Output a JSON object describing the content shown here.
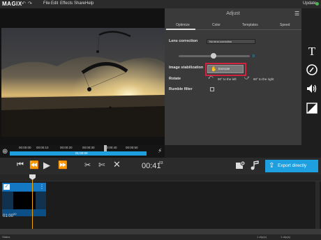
{
  "app": {
    "logo": "MAGIX",
    "undo_icon": "undo-icon",
    "redo_icon": "redo-icon",
    "update_label": "Update"
  },
  "menu": [
    "File",
    "Edit",
    "Effects",
    "Share",
    "Help"
  ],
  "adjust_panel": {
    "title": "Adjust",
    "tabs": [
      "Optimize",
      "Color",
      "Templates",
      "Speed"
    ],
    "active_tab": "Optimize",
    "lens_correction": {
      "label": "Lens correction",
      "selected": "No lens correction",
      "slider_value": "0"
    },
    "image_stabilization": {
      "label": "Image stabilization",
      "button_label": "Execute"
    },
    "rotate": {
      "label": "Rotate",
      "left_label": "90° to the left",
      "right_label": "90° to the right"
    },
    "rumble_filter": {
      "label": "Rumble filter",
      "checked": false
    }
  },
  "right_toolbar": [
    "text-icon",
    "effects-dial-icon",
    "audio-icon",
    "fade-icon"
  ],
  "ruler": {
    "ticks": [
      "00:00:00",
      "00:00:10",
      "00:00:20",
      "00:00:30",
      "00:00:40",
      "00:00:50"
    ],
    "range_label": "01:00:00"
  },
  "transport": {
    "timecode": "00:41",
    "timecode_frames": "03",
    "export_label": "Export directly"
  },
  "clip": {
    "duration": "01:00",
    "duration_frames": "00"
  },
  "status": {
    "left": "Status",
    "middle": "1 clip(s)",
    "right": "1 clip(s)"
  },
  "colors": {
    "accent": "#1e9fe0",
    "highlight": "#d0233f",
    "playhead": "#f0a500"
  }
}
